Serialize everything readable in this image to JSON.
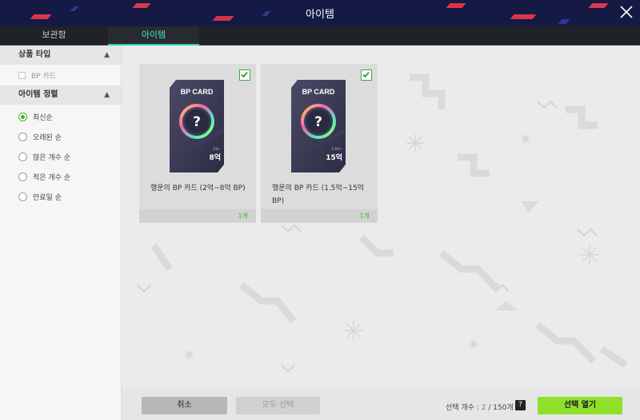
{
  "window": {
    "title": "아이템"
  },
  "tabs": [
    {
      "label": "보관함"
    },
    {
      "label": "아이템"
    }
  ],
  "sidebar": {
    "product_type": {
      "title": "상품 타입",
      "options": [
        {
          "label": "BP 카드",
          "checked": false
        }
      ]
    },
    "sort": {
      "title": "아이템 정렬",
      "options": [
        {
          "label": "최신순",
          "selected": true
        },
        {
          "label": "오래된 순",
          "selected": false
        },
        {
          "label": "많은 개수 순",
          "selected": false
        },
        {
          "label": "적은 개수 순",
          "selected": false
        },
        {
          "label": "만료일 순",
          "selected": false
        }
      ]
    }
  },
  "items": [
    {
      "card_title": "BP CARD",
      "range_small": "2억~",
      "value": "8억",
      "name": "행운의 BP 카드 (2억~8억 BP)",
      "count": "1개",
      "selected": true
    },
    {
      "card_title": "BP CARD",
      "range_small": "1.5억~",
      "value": "15억",
      "name": "행운의 BP 카드 (1.5억~15억 BP)",
      "count": "1개",
      "selected": true
    }
  ],
  "footer": {
    "cancel_label": "취소",
    "select_all_label": "모두 선택",
    "selection_label": "선택 개수 : ",
    "selected_count": "2",
    "capacity": " / 150개",
    "help_label": "?",
    "open_label": "선택 열기"
  },
  "colors": {
    "header_bg": "#141a44",
    "accent_tab": "#4fe3c1",
    "check_green": "#3ca63f",
    "open_button": "#8fe02a"
  },
  "icons": [
    "close-icon",
    "chevron-up-icon",
    "checkbox-icon",
    "radio-icon",
    "checkmark-icon",
    "question-mark-icon",
    "help-icon"
  ]
}
